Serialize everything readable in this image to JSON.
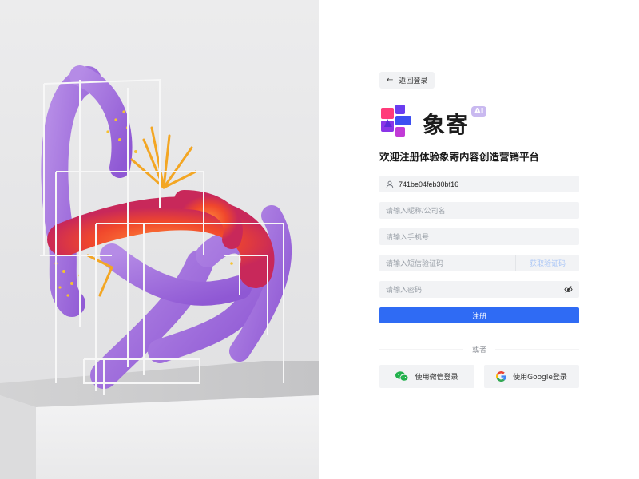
{
  "art": {
    "description_icon": "abstract-3d-sculpture"
  },
  "back": {
    "label": "返回登录",
    "icon": "arrow-left-icon"
  },
  "logo": {
    "text": "象寄",
    "badge": "AI"
  },
  "welcome": "欢迎注册体验象寄内容创造营销平台",
  "form": {
    "invite_value": "741be04feb30bf16",
    "nickname_placeholder": "请输入昵称/公司名",
    "phone_placeholder": "请输入手机号",
    "sms_placeholder": "请输入短信验证码",
    "sms_button": "获取验证码",
    "password_placeholder": "请输入密码",
    "submit_label": "注册"
  },
  "divider_label": "或者",
  "social": {
    "wechat_label": "使用微信登录",
    "google_label": "使用Google登录"
  },
  "colors": {
    "primary": "#2f6bf4",
    "field_bg": "#f2f3f5",
    "sms_link": "#a8c5f6",
    "ai_badge": "#c9b9f0"
  }
}
